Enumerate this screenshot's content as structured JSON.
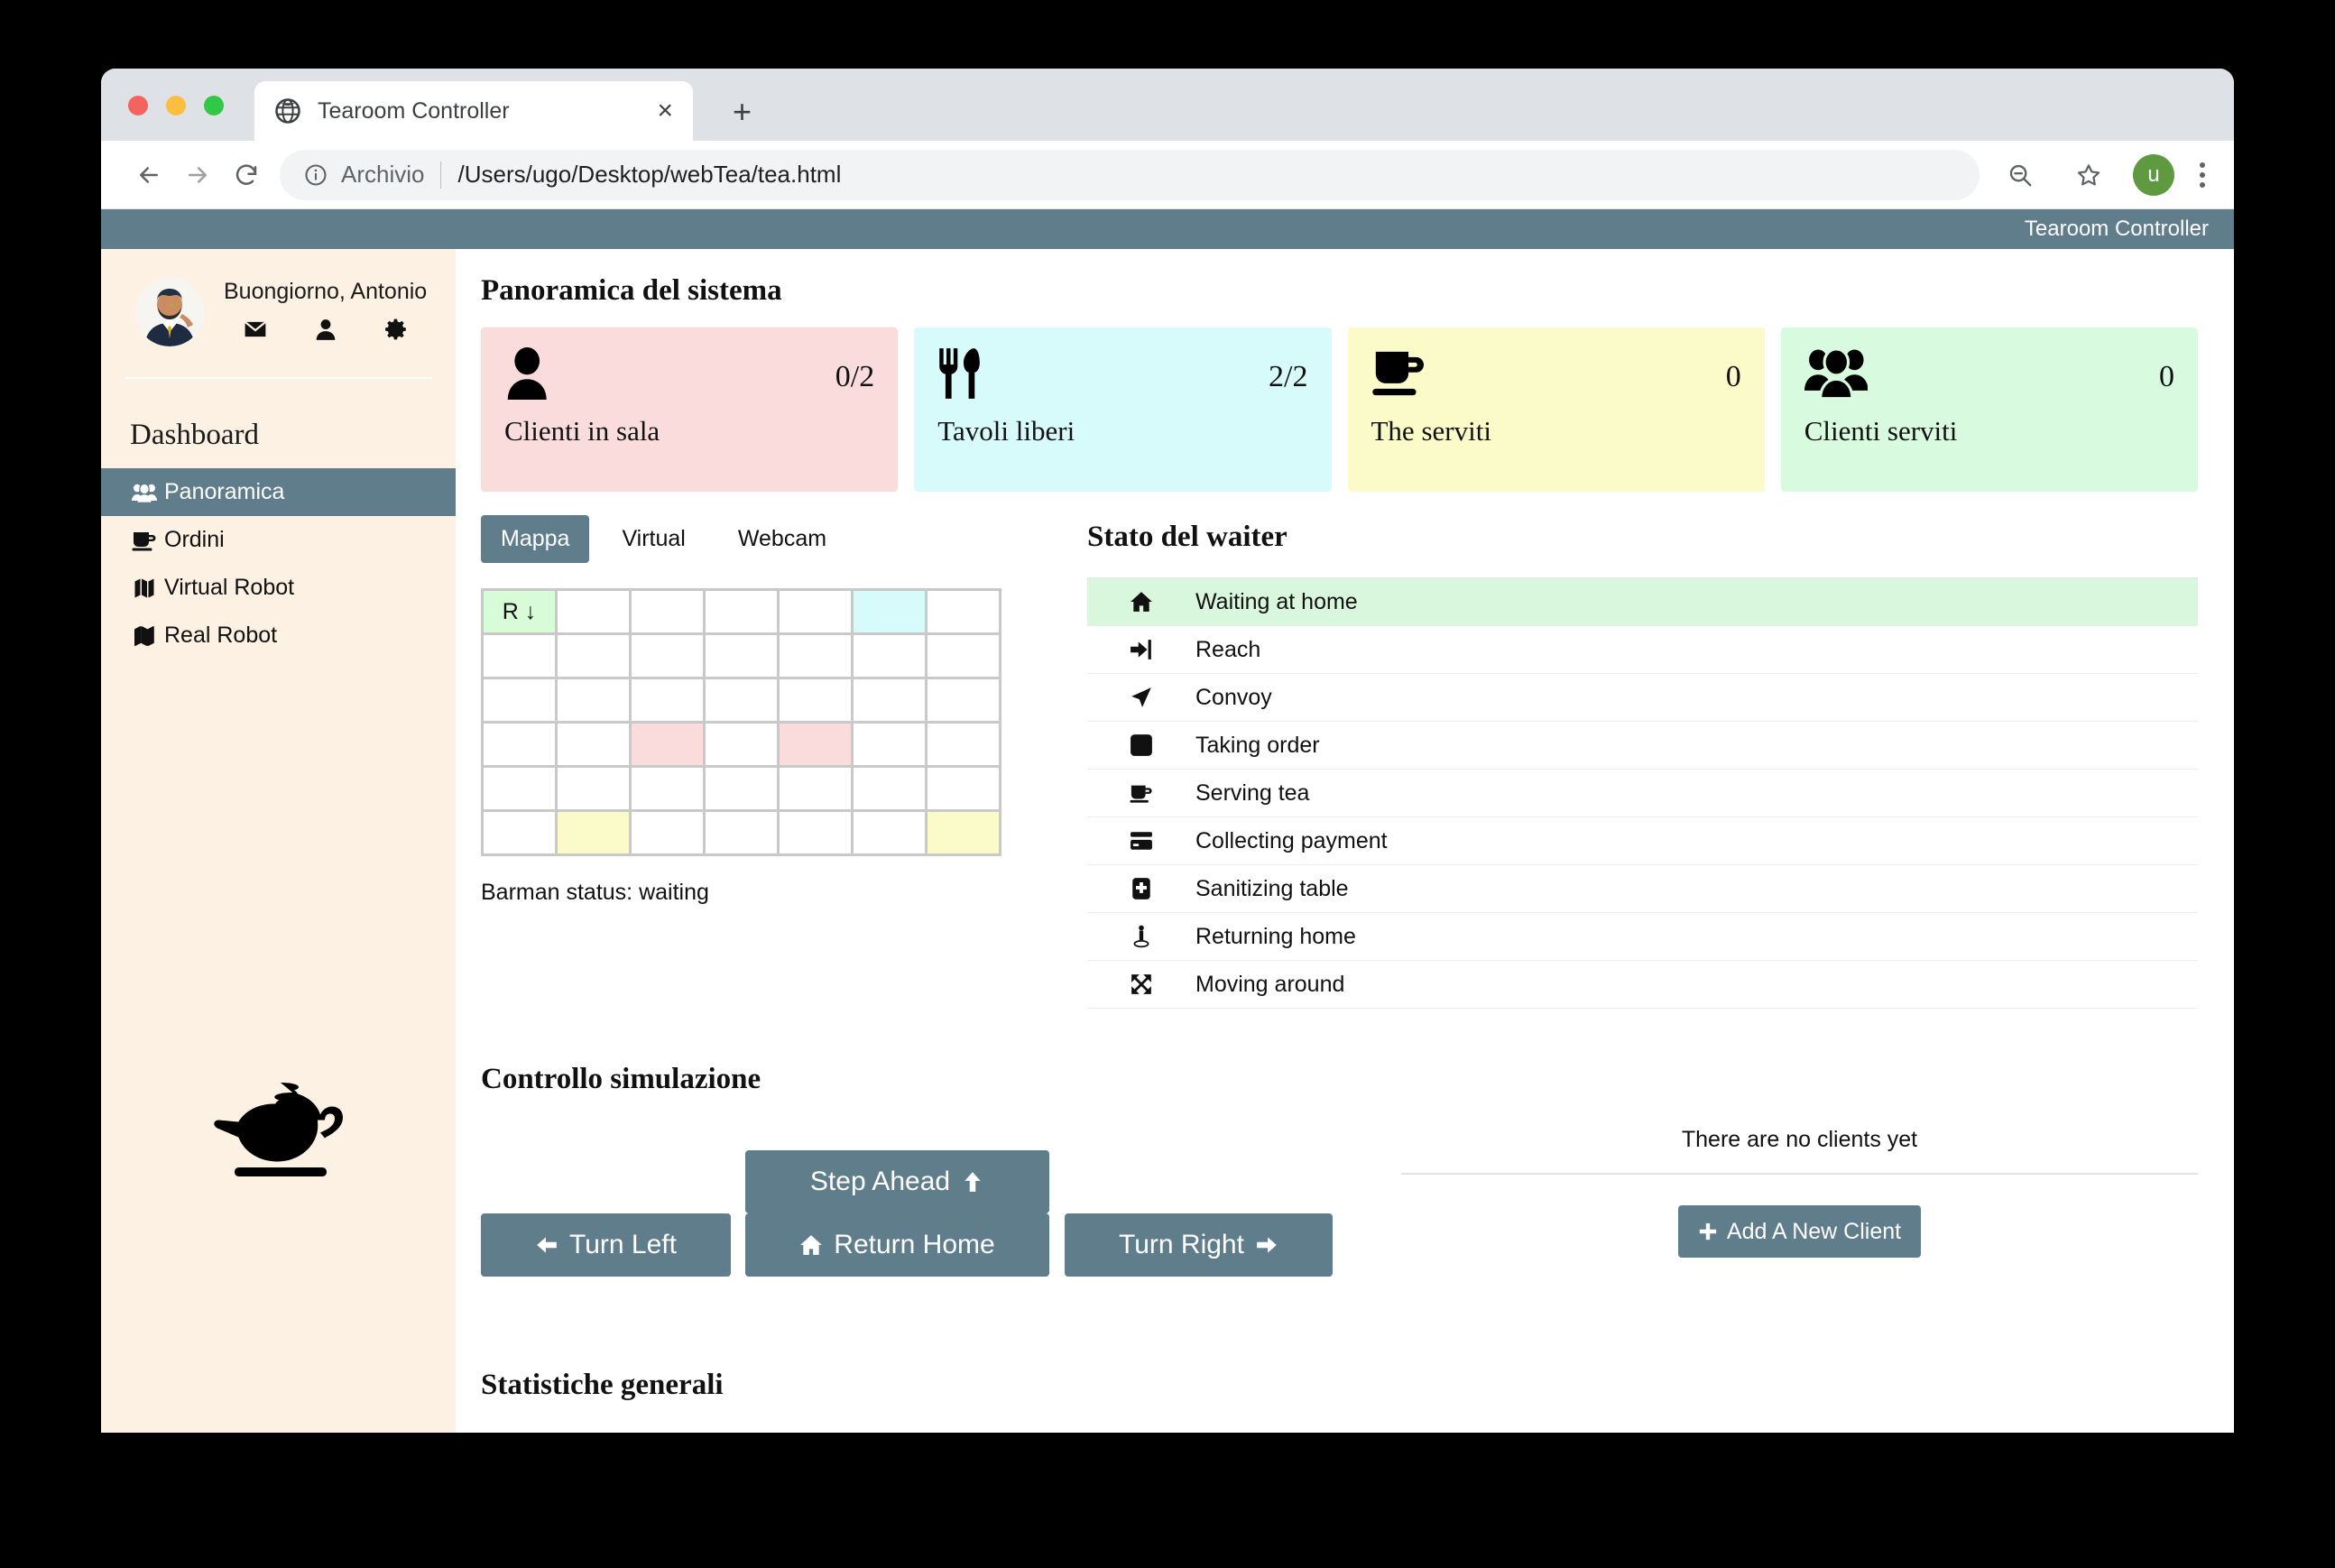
{
  "browser": {
    "tab_title": "Tearoom Controller",
    "tab_favicon": "globe-icon",
    "close_label": "×",
    "newtab_label": "+",
    "omnibox_label": "Archivio",
    "omnibox_url": "/Users/ugo/Desktop/webTea/tea.html",
    "avatar_initial": "u"
  },
  "appbar": {
    "title": "Tearoom Controller"
  },
  "sidebar": {
    "user_name": "Buongiorno, Antonio",
    "user_icons": [
      "envelope-icon",
      "user-icon",
      "gear-icon"
    ],
    "section_title": "Dashboard",
    "items": [
      {
        "label": "Panoramica",
        "icon": "users-icon",
        "active": true
      },
      {
        "label": "Ordini",
        "icon": "coffee-icon",
        "active": false
      },
      {
        "label": "Virtual Robot",
        "icon": "map-filled-icon",
        "active": false
      },
      {
        "label": "Real Robot",
        "icon": "map-outline-icon",
        "active": false
      }
    ]
  },
  "main": {
    "overview_title": "Panoramica del sistema",
    "cards": [
      {
        "icon": "person-icon",
        "value": "0/2",
        "label": "Clienti in sala",
        "bg": "#fbdcdc"
      },
      {
        "icon": "cutlery-icon",
        "value": "2/2",
        "label": "Tavoli liberi",
        "bg": "#d7fbfb"
      },
      {
        "icon": "teacup-icon",
        "value": "0",
        "label": "The serviti",
        "bg": "#fbfbc9"
      },
      {
        "icon": "group-icon",
        "value": "0",
        "label": "Clienti serviti",
        "bg": "#d8fbe0"
      }
    ],
    "view_tabs": [
      {
        "label": "Mappa",
        "active": true
      },
      {
        "label": "Virtual",
        "active": false
      },
      {
        "label": "Webcam",
        "active": false
      }
    ],
    "map": {
      "cols": 7,
      "rows": 6,
      "cells": [
        {
          "r": 0,
          "c": 0,
          "text": "R ↓",
          "bg": "#d8fbd8"
        },
        {
          "r": 0,
          "c": 5,
          "text": "",
          "bg": "#d7fbfb"
        },
        {
          "r": 3,
          "c": 2,
          "text": "",
          "bg": "#fbdcdc"
        },
        {
          "r": 3,
          "c": 4,
          "text": "",
          "bg": "#fbdcdc"
        },
        {
          "r": 5,
          "c": 1,
          "text": "",
          "bg": "#fbfbc9"
        },
        {
          "r": 5,
          "c": 6,
          "text": "",
          "bg": "#fbfbc9"
        }
      ]
    },
    "barman_status": "Barman status: waiting",
    "waiter_title": "Stato del waiter",
    "waiter_states": [
      {
        "icon": "home-icon",
        "label": "Waiting at home",
        "active": true
      },
      {
        "icon": "sign-in-icon",
        "label": "Reach",
        "active": false
      },
      {
        "icon": "location-arrow-icon",
        "label": "Convoy",
        "active": false
      },
      {
        "icon": "edit-icon",
        "label": "Taking order",
        "active": false
      },
      {
        "icon": "coffee-icon",
        "label": "Serving tea",
        "active": false
      },
      {
        "icon": "credit-card-icon",
        "label": "Collecting payment",
        "active": false
      },
      {
        "icon": "first-aid-icon",
        "label": "Sanitizing table",
        "active": false
      },
      {
        "icon": "map-pin-icon",
        "label": "Returning home",
        "active": false
      },
      {
        "icon": "expand-arrows-icon",
        "label": "Moving around",
        "active": false
      }
    ],
    "sim_title": "Controllo simulazione",
    "buttons": {
      "step": "Step Ahead",
      "turn_left": "Turn Left",
      "return_home": "Return Home",
      "turn_right": "Turn Right"
    },
    "clients": {
      "empty_text": "There are no clients yet",
      "add_label": "Add A New Client"
    },
    "stats_title": "Statistiche generali"
  },
  "colors": {
    "accent": "#607d8b",
    "sidebar_bg": "#fdf1e3",
    "active_row": "#d9f7dd"
  }
}
